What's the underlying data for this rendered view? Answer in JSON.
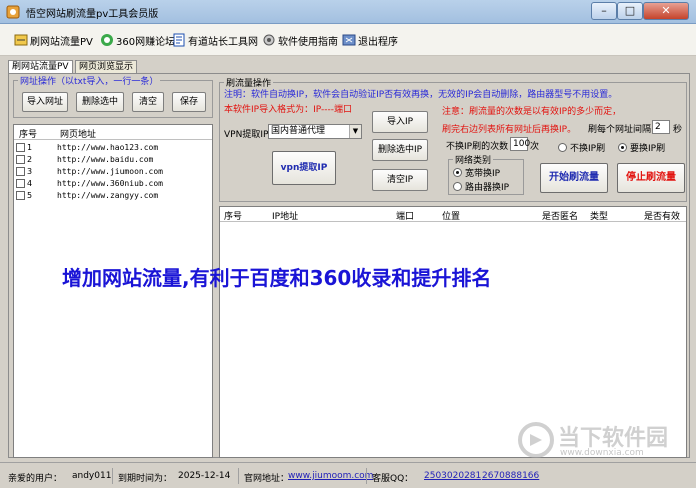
{
  "window": {
    "title": "悟空网站刷流量pv工具会员版",
    "controls": {
      "minimize": "–",
      "maximize": "□",
      "close": "✕"
    }
  },
  "toolbar": {
    "items": [
      {
        "label": "刷网站流量PV",
        "icon": "refresh-icon"
      },
      {
        "label": "360网赚论坛",
        "icon": "360-icon"
      },
      {
        "label": "有道站长工具网",
        "icon": "youdao-icon"
      },
      {
        "label": "软件使用指南",
        "icon": "guide-icon"
      },
      {
        "label": "退出程序",
        "icon": "exit-icon"
      }
    ]
  },
  "tabs": [
    {
      "label": "刷网站流量PV",
      "active": true
    },
    {
      "label": "网页浏览显示",
      "active": false
    }
  ],
  "url_panel": {
    "group_label": "网址操作",
    "group_hint": "（以txt导入，一行一条）",
    "buttons": {
      "import": "导入网址",
      "delete": "删除选中",
      "clear": "清空",
      "save": "保存"
    },
    "columns": {
      "num": "序号",
      "url": "网页地址"
    },
    "rows": [
      {
        "num": "1",
        "url": "http://www.hao123.com"
      },
      {
        "num": "2",
        "url": "http://www.baidu.com"
      },
      {
        "num": "3",
        "url": "http://www.jiumoon.com"
      },
      {
        "num": "4",
        "url": "http://www.360niub.com"
      },
      {
        "num": "5",
        "url": "http://www.zangyy.com"
      }
    ]
  },
  "traffic_panel": {
    "group_label": "刷流量操作",
    "note1": "注明：软件自动换IP，软件会自动验证IP否有效再换，无效的IP会自动删除，路由器型号不用设置。",
    "note2": "本软件IP导入格式为：IP----端口",
    "note3": "注意：刷流量的次数是以有效IP的多少而定，",
    "note4": "刷完右边列表所有网址后再换IP。",
    "vpn_label": "VPN提取IP",
    "vpn_selected": "国内普通代理",
    "btn_import_ip": "导入IP",
    "btn_delete_ip": "删除选中IP",
    "btn_clear_ip": "清空IP",
    "btn_vpn": "vpn提取IP",
    "interval_label": "刷每个网址间隔",
    "interval_value": "2",
    "interval_unit": "秒",
    "count_label": "不换IP刷的次数",
    "count_value": "100",
    "count_unit": "次",
    "net_type_label": "网络类别",
    "net_options": [
      {
        "label": "宽带换IP",
        "selected": true
      },
      {
        "label": "路由器换IP",
        "selected": false
      }
    ],
    "ip_mode_options": [
      {
        "label": "不换IP刷",
        "selected": false
      },
      {
        "label": "要换IP刷",
        "selected": true
      }
    ],
    "btn_start": "开始刷流量",
    "btn_stop": "停止刷流量"
  },
  "ip_table": {
    "columns": [
      "序号",
      "IP地址",
      "端口",
      "位置",
      "是否匿名",
      "类型",
      "是否有效"
    ]
  },
  "promo_text": "增加网站流量,有利于百度和360收录和提升排名",
  "status": {
    "user_label": "亲爱的用户：",
    "user_value": "andy011",
    "expire_label": "到期时间为：",
    "expire_value": "2025-12-14",
    "site_label": "官网地址：",
    "site_value": "www.jiumoom.com",
    "qq_label": "客服QQ：",
    "qq1": "2503020281",
    "qq2": "2670888166"
  },
  "watermark": {
    "text": "当下软件园",
    "sub": "www.downxia.com"
  },
  "colors": {
    "accent_blue": "#1a14d6",
    "note_blue": "#2a2ad8",
    "note_red": "#e2120e",
    "stop_red": "#e2120e",
    "start_blue": "#1f2bb0"
  }
}
